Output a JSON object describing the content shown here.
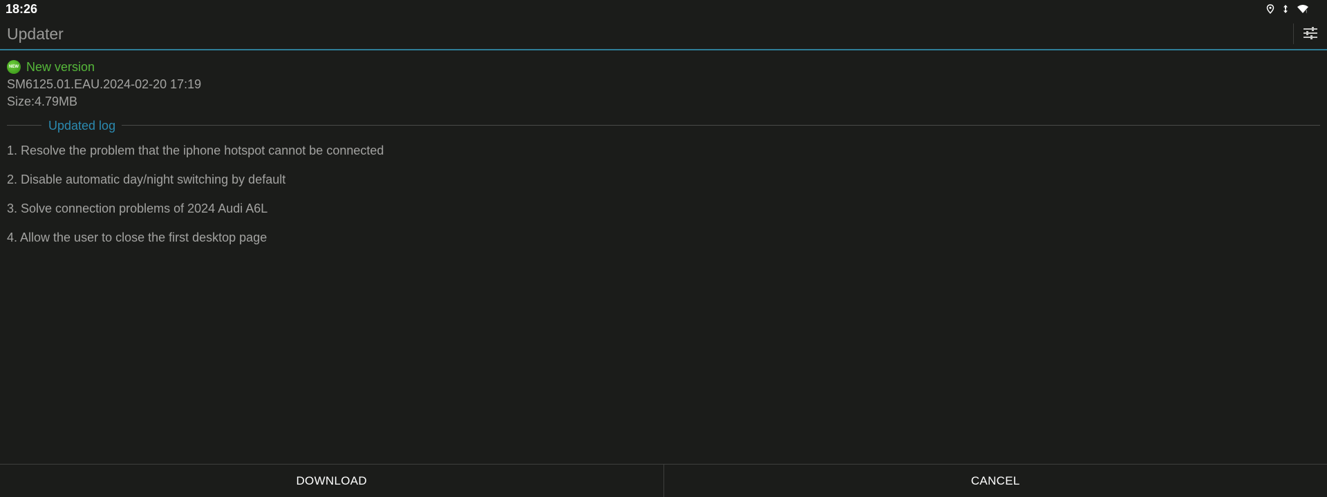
{
  "status_bar": {
    "time": "18:26",
    "icons": [
      "location-icon",
      "data-arrows-icon",
      "wifi-icon"
    ]
  },
  "action_bar": {
    "title": "Updater",
    "settings_icon": "sliders-icon"
  },
  "update": {
    "badge_text": "NEW",
    "heading": "New version",
    "version": "SM6125.01.EAU.2024-02-20 17:19",
    "size": "Size:4.79MB"
  },
  "log": {
    "title": "Updated log",
    "items": [
      "1. Resolve the problem that the iphone hotspot cannot be connected",
      "2. Disable automatic day/night switching by default",
      "3. Solve connection problems of 2024 Audi A6L",
      "4. Allow the user to close the first desktop page"
    ]
  },
  "buttons": {
    "download": "DOWNLOAD",
    "cancel": "CANCEL"
  },
  "colors": {
    "background": "#1b1c1a",
    "accent": "#2f7f99",
    "new_green": "#56b83a",
    "log_title": "#2b8ab0"
  }
}
